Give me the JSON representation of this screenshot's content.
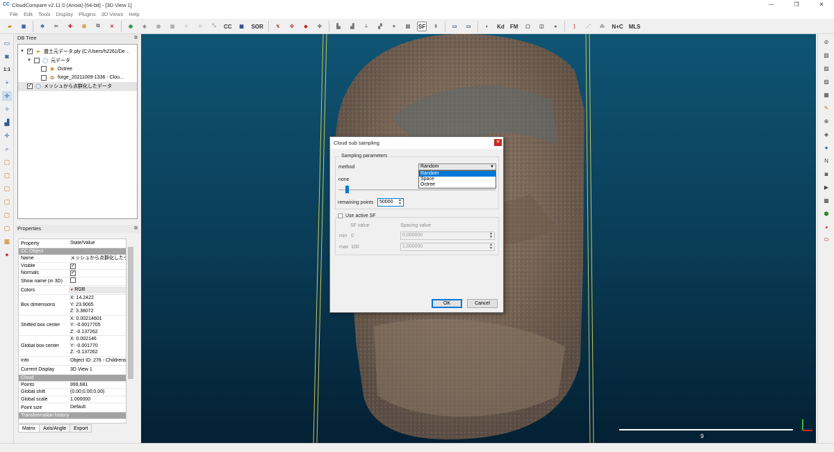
{
  "window": {
    "title": "CloudCompare v2.11.0 (Anoia) [64-bit] - [3D View 1]",
    "app_icon": "CC",
    "buttons": [
      "—",
      "❐",
      "✕"
    ]
  },
  "menu": [
    "File",
    "Edit",
    "Tools",
    "Display",
    "Plugins",
    "3D Views",
    "Help"
  ],
  "toolbar": {
    "sor_label": "SOR",
    "sf_label": "SF",
    "kd_label": "Kd",
    "fm_label": "FM",
    "nc_label": "N+C",
    "mls_label": "MLS",
    "cc_label": "CC"
  },
  "leftstrip_numlabel": "1:1",
  "db_tree": {
    "title": "DB Tree",
    "items": [
      {
        "label": "盛土元データ.ply (C:/Users/h2261/De…",
        "checked": true,
        "expanded": true
      },
      {
        "label": "元データ",
        "checked": false,
        "expanded": true
      },
      {
        "label": "Octree",
        "checked": false
      },
      {
        "label": "forge_20211009-1336 - Clou…",
        "checked": false
      },
      {
        "label": "メッシュから点群化したデータ",
        "checked": true
      }
    ]
  },
  "properties": {
    "title": "Properties",
    "header": {
      "property": "Property",
      "value": "State/Value"
    },
    "sections": {
      "ccobject": "CC Object",
      "cloud": "Cloud",
      "transform": "Transformation history"
    },
    "rows": {
      "name": {
        "k": "Name",
        "v": "メッシュから点群化したデータ"
      },
      "visible": {
        "k": "Visible"
      },
      "normals": {
        "k": "Normals"
      },
      "showname": {
        "k": "Show name (in 3D)"
      },
      "colors": {
        "k": "Colors",
        "v": "RGB"
      },
      "boxdim": {
        "k": "Box dimensions",
        "v1": "X: 14.2422",
        "v2": "Y: 23.9065",
        "v3": "Z: 3.38072"
      },
      "shifted": {
        "k": "Shifted box center",
        "v1": "X: 0.00214601",
        "v2": "Y: -0.0017705",
        "v3": "Z: -0.137262"
      },
      "global": {
        "k": "Global box center",
        "v1": "X: 0.002146",
        "v2": "Y: -0.001770",
        "v3": "Z: -0.137262"
      },
      "info": {
        "k": "Info",
        "v": "Object ID: 276 - Childrens"
      },
      "display": {
        "k": "Current Display",
        "v": "3D View 1"
      },
      "points": {
        "k": "Points",
        "v": "999,681"
      },
      "gshift": {
        "k": "Global shift",
        "v": "(0.00;0.00;0.00)"
      },
      "gscale": {
        "k": "Global scale",
        "v": "1.000000"
      },
      "psize": {
        "k": "Point size",
        "v": "Default"
      }
    },
    "tabs": [
      "Matrix",
      "Axis/Angle",
      "Export"
    ]
  },
  "view": {
    "scale_label": "9",
    "bg_top": "#0f5474",
    "bg_bottom": "#042033"
  },
  "dialog": {
    "title": "Cloud sub sampling",
    "group_sampling": "Sampling parameters",
    "method_label": "method",
    "method_value": "Random",
    "method_options": [
      "Random",
      "Space",
      "Octree"
    ],
    "none_label": "none",
    "remaining_label": "remaining points",
    "remaining_value": "50000",
    "use_sf_label": "Use active SF",
    "sf_value_header": "SF value",
    "spacing_header": "Spacing value",
    "min_label": "min",
    "min_sf": "0",
    "min_spacing": "0.000000",
    "max_label": "max",
    "max_sf": "100",
    "max_spacing": "1.000000",
    "ok_label": "OK",
    "cancel_label": "Cancel"
  }
}
